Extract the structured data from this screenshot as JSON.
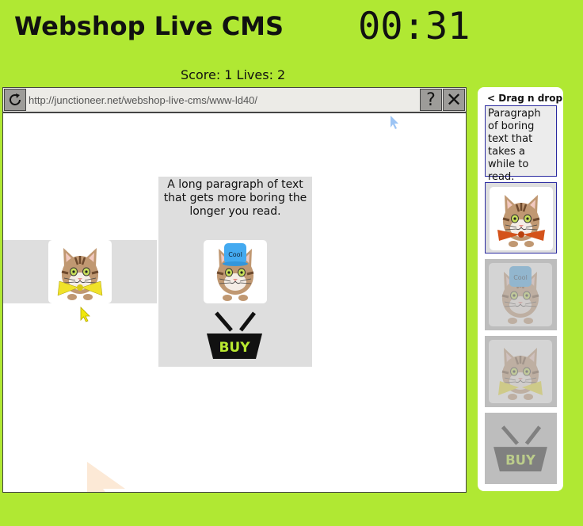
{
  "header": {
    "title": "Webshop Live CMS",
    "timer": "00:31"
  },
  "status": {
    "score_lives": "Score: 1 Lives: 2"
  },
  "browser": {
    "url": "http://junctioneer.net/webshop-live-cms/www-ld40/",
    "help_label": "?",
    "close_label": "✕",
    "reload_icon": "reload-icon"
  },
  "page": {
    "paragraph": "A long paragraph of text that gets more boring the longer you read.",
    "buy_label": "BUY",
    "hat_label": "Cool"
  },
  "panel": {
    "title": "< Drag n drop",
    "text_item": "Paragraph of boring text that takes a while to read.",
    "hat_label": "Cool",
    "buy_label": "BUY"
  },
  "colors": {
    "background": "#b0e833",
    "slot_border": "#2a2aa0",
    "buy_text": "#b8e830",
    "bow_yellow": "#f0e22a",
    "bow_orange": "#d4521a",
    "hat_blue": "#44aaf0"
  }
}
